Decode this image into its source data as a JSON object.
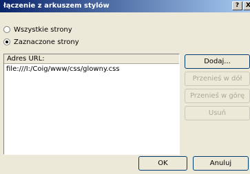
{
  "window": {
    "title": "łączenie z arkuszem stylów",
    "help_label": "?",
    "close_label": "X"
  },
  "options": {
    "all_pages_label": "Wszystkie strony",
    "selected_pages_label": "Zaznaczone strony",
    "selected": "selected_pages"
  },
  "list": {
    "header": "Adres URL:",
    "items": [
      "file:///I:/Coig/www/css/glowny.css"
    ]
  },
  "buttons": {
    "add": "Dodaj...",
    "move_down": "Przenieś w dół",
    "move_up": "Przenieś w górę",
    "remove": "Usuń",
    "ok": "OK",
    "cancel": "Anuluj"
  }
}
